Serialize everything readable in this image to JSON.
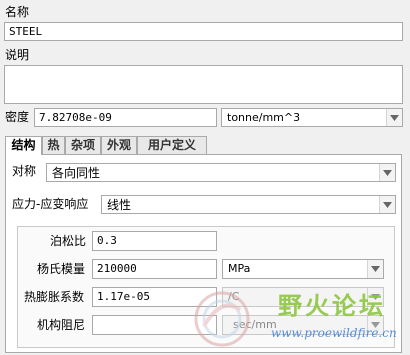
{
  "name": {
    "label": "名称",
    "value": "STEEL"
  },
  "description": {
    "label": "说明",
    "value": ""
  },
  "density": {
    "label": "密度",
    "value": "7.82708e-09",
    "unit": "tonne/mm^3"
  },
  "tabs": [
    {
      "label": "结构",
      "active": true
    },
    {
      "label": "热",
      "active": false
    },
    {
      "label": "杂项",
      "active": false
    },
    {
      "label": "外观",
      "active": false
    },
    {
      "label": "用户定义",
      "active": false
    }
  ],
  "symmetry": {
    "label": "对称",
    "value": "各向同性"
  },
  "stress_strain": {
    "label": "应力-应变响应",
    "value": "线性"
  },
  "poisson": {
    "label": "泊松比",
    "value": "0.3"
  },
  "youngs": {
    "label": "杨氏模量",
    "value": "210000",
    "unit": "MPa"
  },
  "thermal_expansion": {
    "label": "热膨胀系数",
    "value": "1.17e-05",
    "unit": "/C"
  },
  "damping": {
    "label": "机构阻尼",
    "value": "",
    "unit": "sec/mm"
  },
  "watermark": {
    "text_cn": "野火论坛",
    "url": "www.proewildfire.cn"
  },
  "colors": {
    "watermark_green": "#8dc63f",
    "watermark_blue": "#3a7bd5"
  }
}
